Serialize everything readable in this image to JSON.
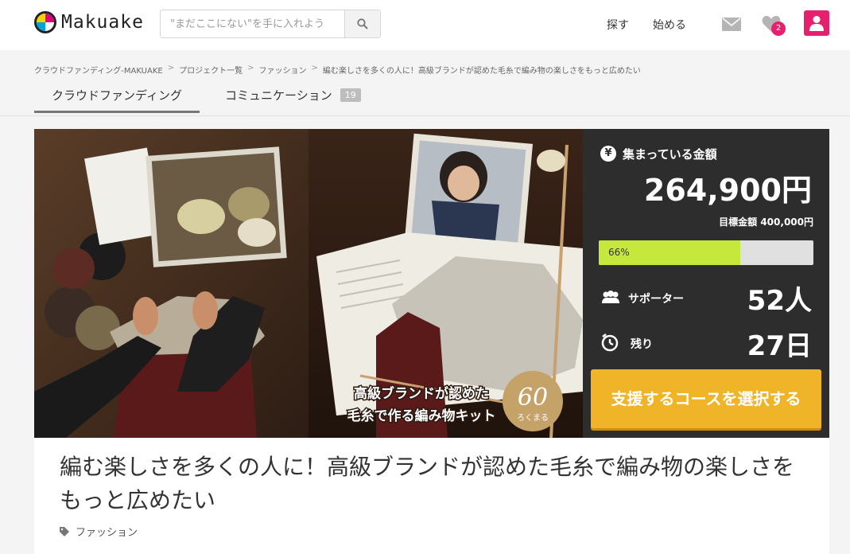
{
  "header": {
    "logo_text": "Makuake",
    "search_placeholder": "\"まだここにない\"を手に入れよう",
    "nav": [
      "探す",
      "始める"
    ],
    "notification_count": "2",
    "accent_color": "#e7206d"
  },
  "breadcrumb": [
    "クラウドファンディング-MAKUAKE",
    "プロジェクト一覧",
    "ファッション",
    "編む楽しさを多くの人に！高級ブランドが認めた毛糸で編み物の楽しさをもっと広めたい"
  ],
  "breadcrumb_sep": ">",
  "tabs": [
    {
      "label": "クラウドファンディング",
      "active": true
    },
    {
      "label": "コミュニケーション",
      "count": "19"
    }
  ],
  "hero": {
    "caption_line1": "高級ブランドが認めた",
    "caption_line2": "毛糸で作る編み物キット",
    "badge_number": "60",
    "badge_text": "ろくまる"
  },
  "stats": {
    "yen_symbol": "¥",
    "collected_label": "集まっている金額",
    "amount": "264,900円",
    "target": "目標金額 400,000円",
    "progress_percent": 66,
    "progress_text": "66%",
    "supporters_label": "サポーター",
    "supporters_value": "52人",
    "remaining_label": "残り",
    "remaining_value": "27日",
    "cta_label": "支援するコースを選択する",
    "cta_color": "#f0b428",
    "progress_color": "#c6e83c"
  },
  "project": {
    "title": "編む楽しさを多くの人に！高級ブランドが認めた毛糸で編み物の楽しさをもっと広めたい",
    "category": "ファッション"
  }
}
